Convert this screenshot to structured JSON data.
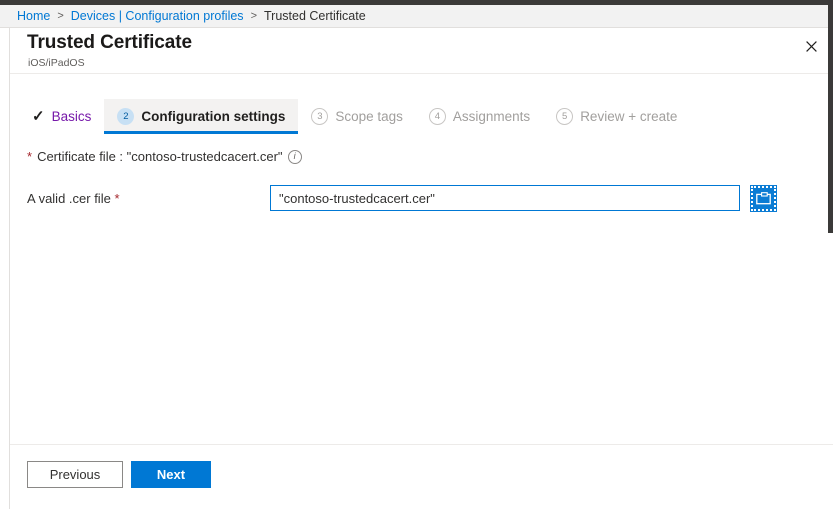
{
  "breadcrumb": {
    "items": [
      {
        "label": "Home",
        "link": true
      },
      {
        "label": "Devices | Configuration profiles",
        "link": true
      },
      {
        "label": "Trusted Certificate",
        "link": false
      }
    ],
    "separator": ">"
  },
  "blade": {
    "title": "Trusted Certificate",
    "subtitle": "iOS/iPadOS",
    "close_icon": "close-icon",
    "close_label": "✕"
  },
  "wizard": {
    "tabs": [
      {
        "badge": "✓",
        "label": "Basics",
        "state": "completed"
      },
      {
        "badge": "2",
        "label": "Configuration settings",
        "state": "active"
      },
      {
        "badge": "3",
        "label": "Scope tags",
        "state": "disabled"
      },
      {
        "badge": "4",
        "label": "Assignments",
        "state": "disabled"
      },
      {
        "badge": "5",
        "label": "Review + create",
        "state": "disabled"
      }
    ]
  },
  "form": {
    "required_marker": "*",
    "certificate_file_text": "Certificate file : \"contoso-trustedcacert.cer\"",
    "info_icon": "info-icon",
    "info_glyph": "i",
    "field_label": "A valid .cer file",
    "field_value": "\"contoso-trustedcacert.cer\"",
    "field_placeholder": "",
    "browse_icon": "folder-browse-icon"
  },
  "footer": {
    "previous_label": "Previous",
    "next_label": "Next"
  },
  "colors": {
    "accent": "#0078d4",
    "visited_link": "#7719aa",
    "required": "#a4262c",
    "badge_active_bg": "#c7e0f4",
    "disabled_text": "#a19f9d"
  }
}
